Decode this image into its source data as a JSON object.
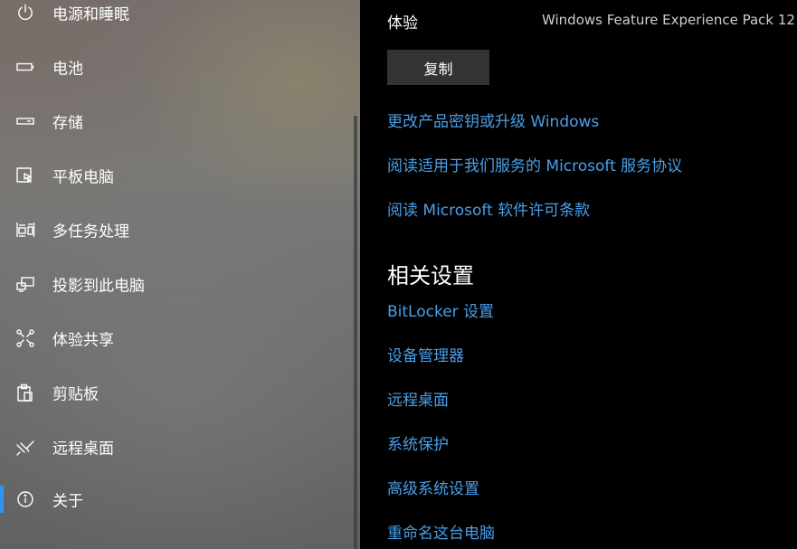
{
  "sidebar": {
    "items": [
      {
        "label": "电源和睡眠",
        "icon": "power-icon"
      },
      {
        "label": "电池",
        "icon": "battery-icon"
      },
      {
        "label": "存储",
        "icon": "storage-icon"
      },
      {
        "label": "平板电脑",
        "icon": "tablet-mode-icon"
      },
      {
        "label": "多任务处理",
        "icon": "multitasking-icon"
      },
      {
        "label": "投影到此电脑",
        "icon": "project-to-pc-icon"
      },
      {
        "label": "体验共享",
        "icon": "shared-experiences-icon"
      },
      {
        "label": "剪贴板",
        "icon": "clipboard-icon"
      },
      {
        "label": "远程桌面",
        "icon": "remote-desktop-icon"
      },
      {
        "label": "关于",
        "icon": "info-icon",
        "selected": true
      }
    ],
    "accent_color": "#2f95ee"
  },
  "main": {
    "spec": {
      "label": "体验",
      "value": "Windows Feature Experience Pack 12"
    },
    "copy_button_label": "复制",
    "links": [
      "更改产品密钥或升级 Windows",
      "阅读适用于我们服务的 Microsoft 服务协议",
      "阅读 Microsoft 软件许可条款"
    ],
    "related_settings": {
      "heading": "相关设置",
      "links": [
        "BitLocker 设置",
        "设备管理器",
        "远程桌面",
        "系统保护",
        "高级系统设置",
        "重命名这台电脑"
      ]
    },
    "link_color": "#4a9fe8"
  }
}
